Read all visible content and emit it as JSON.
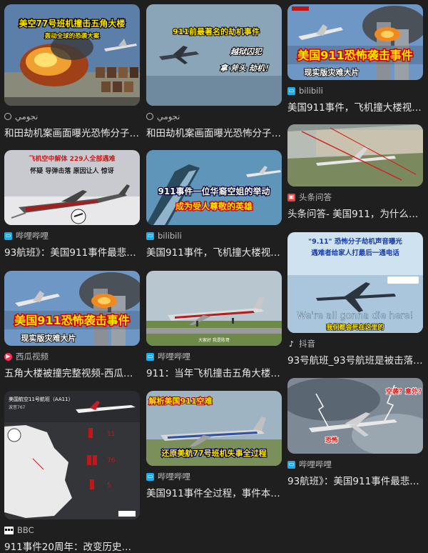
{
  "results": [
    {
      "source": "نجومي",
      "title": "和田劫机案画面曝光恐怖分子企图…",
      "thumb_caption": "美空77号班机撞击五角大楼",
      "thumb_subcaption": "轰动全球的恐袭大案"
    },
    {
      "source": "نجومي",
      "title": "和田劫机案画面曝光恐怖分子企图…",
      "thumb_caption": "911前最著名的劫机事件",
      "thumb_subcaption": "越狱囚犯",
      "thumb_subcaption2": "拿 斧头 劫机！"
    },
    {
      "source": "bilibili",
      "title": "美国911事件，飞机撞大楼视频…",
      "thumb_caption": "美国911恐怖袭击事件",
      "thumb_subcaption": "现实版灾难大片"
    },
    {
      "source": "哔哩哔哩",
      "title": "93航班》：美国911事件最悲壮…",
      "thumb_caption": "飞机空中解体  229人全部遇难",
      "thumb_subcaption": "怀疑 导弹击落  原因让人 惊讶"
    },
    {
      "source": "bilibili",
      "title": "美国911事件，飞机撞大楼视频…",
      "thumb_caption": "911事件一位华裔空姐的举动",
      "thumb_subcaption": "成为受人尊敬的英雄"
    },
    {
      "source": "头条问答",
      "title": "头条问答- 美国911，为什么…"
    },
    {
      "source": "西瓜视频",
      "title": "五角大楼被撞完整视频-西瓜视频",
      "thumb_caption": "美国911恐怖袭击事件",
      "thumb_subcaption": "现实版灾难大片"
    },
    {
      "source": "哔哩哔哩",
      "title": "911：当年飞机撞击五角大楼的…",
      "thumb_caption": "大家好 我是陈哥"
    },
    {
      "source": "抖音",
      "title": "93号航班_93号航班是被击落的吗…",
      "thumb_caption": "\"9.11\" 恐怖分子劫机声音曝光",
      "thumb_subcaption": "遇难者给家人打最后一通电话",
      "thumb_subcaption2": "We're all gonna die here!",
      "thumb_subcaption3": "我们都会死在这里的"
    },
    {
      "source": "BBC",
      "title": "911事件20周年：改变历史的那…",
      "thumb_caption": "美国航空11号航班（AA11）",
      "thumb_subcaption": "波音767",
      "thumb_stats": [
        "11",
        "76",
        "5"
      ]
    },
    {
      "source": "哔哩哔哩",
      "title": "美国911事件全过程，事件本身比…",
      "thumb_caption": "解析美国911空难",
      "thumb_subcaption": "还原美航77号班机失事全过程"
    },
    {
      "source": "哔哩哔哩",
      "title": "93航班》：美国911事件最悲壮…",
      "thumb_caption": "空袭？意外？",
      "thumb_subcaption": "恐怖"
    }
  ]
}
